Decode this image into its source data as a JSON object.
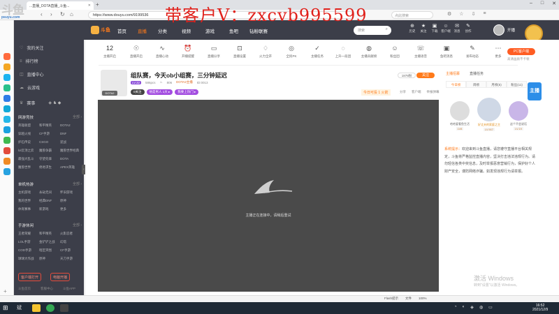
{
  "browser": {
    "tab_title": "...直播_DOTA直播_斗鱼...",
    "url": "https://www.douyu.com/9199536",
    "search_placeholder": "点此搜索"
  },
  "watermark": {
    "logo": "斗鱼",
    "sub": "psuyu.com",
    "contact": "带客户V：zxcvb995599"
  },
  "header": {
    "logo_text": "斗鱼",
    "nav": [
      "首页",
      "直播",
      "分类",
      "视频",
      "游戏",
      "鱼吧",
      "钻粉联赛"
    ],
    "search_placeholder": "搜索",
    "icons": [
      {
        "glyph": "⊕",
        "label": "历史"
      },
      {
        "glyph": "★",
        "label": "关注"
      },
      {
        "glyph": "▣",
        "label": "下载"
      },
      {
        "glyph": "☺",
        "label": "客户端"
      },
      {
        "glyph": "✉",
        "label": "消息"
      },
      {
        "glyph": "✎",
        "label": "创作"
      }
    ],
    "open_live": "开播"
  },
  "sidebar": {
    "items": [
      {
        "icon": "♡",
        "label": "我的关注"
      },
      {
        "icon": "≡",
        "label": "排行榜"
      },
      {
        "icon": "◫",
        "label": "直播中心"
      },
      {
        "icon": "☁",
        "label": "云游戏"
      }
    ],
    "match": "赛事",
    "sections": [
      {
        "title": "网游竞技",
        "all": "全部 ›",
        "games": [
          "英雄联盟",
          "和平精英",
          "DOTA2",
          "穿越火线",
          "CF手游",
          "DNF",
          "炉石传说",
          "CSGO",
          "逆战",
          "lol云顶之弈",
          "魔兽争霸",
          "魔兽世界经典",
          "最强大乱斗",
          "守望先锋",
          "DOTA",
          "魔兽世界",
          "绝地求生",
          "APEX英雄"
        ]
      },
      {
        "title": "单机热游",
        "all": "全部 ›",
        "games": [
          "主机游戏",
          "永劫无间",
          "怀旧游戏",
          "我的世界",
          "经典DNF",
          "原神",
          "体育赛事",
          "新游戏",
          "更多"
        ]
      },
      {
        "title": "手游休闲",
        "all": "全部 ›",
        "games": [
          "王者荣耀",
          "和平精英",
          "火影忍者",
          "LOL手游",
          "金铲铲之战",
          "幻塔",
          "COD手游",
          "暗区突围",
          "CF手游",
          "球球大作战",
          "原神",
          "天刀手游"
        ]
      }
    ],
    "btn_open": "客户端打开",
    "btn_download": "电脑开播",
    "foot": [
      "斗鱼首页",
      "客服中心",
      "斗鱼APP"
    ]
  },
  "toolbar": {
    "count": "12",
    "count_label": "主播开启",
    "items": [
      {
        "glyph": "☉",
        "label": "直播开启"
      },
      {
        "glyph": "∿",
        "label": "直播心动"
      },
      {
        "glyph": "⏰",
        "label": "开播提醒"
      },
      {
        "glyph": "▭",
        "label": "直播分享"
      },
      {
        "glyph": "⊡",
        "label": "直播设置"
      },
      {
        "glyph": "♢",
        "label": "火力全开"
      },
      {
        "glyph": "◎",
        "label": "全民PK"
      },
      {
        "glyph": "✓",
        "label": "主播任务"
      },
      {
        "glyph": "◌",
        "label": "上升一段团"
      },
      {
        "glyph": "◍",
        "label": "主播贡献榜"
      },
      {
        "glyph": "☺",
        "label": "粉丝团"
      },
      {
        "glyph": "☏",
        "label": "主播语音"
      },
      {
        "glyph": "▣",
        "label": "鱼吧消息"
      },
      {
        "glyph": "✎",
        "label": "发布动态"
      },
      {
        "glyph": "⋯",
        "label": "更多"
      }
    ],
    "pc_btn": "PC客户端",
    "pc_sub": "高清画质不卡顿"
  },
  "room": {
    "thumb_tag": "DOTA2",
    "title": "组队赛，今天ob小组赛，三分钟延迟",
    "report": "举报",
    "level": "LV.32",
    "follow_count": "1878粉",
    "follow": "关注",
    "meta": [
      "586pcs",
      "806",
      "DOTA2主播",
      "ID:0013"
    ],
    "tags": [
      {
        "text": "0关注",
        "color": "#444"
      },
      {
        "text": "他是男人 1大 ▸",
        "color": "#a34de0"
      },
      {
        "text": "我要上热门 ▸",
        "color": "#a34de0"
      }
    ],
    "today_rank": "今日可投 1 火箭",
    "share_items": [
      "分享",
      "客户端",
      "举报弹幕"
    ]
  },
  "video": {
    "status": "主播正在连接中，请稍后重试"
  },
  "right": {
    "top_tabs": [
      "主播招募",
      "直播任务"
    ],
    "tabs": [
      "今日榜",
      "周榜",
      "月榜(5)",
      "粉丝(11)"
    ],
    "ranks": [
      {
        "name": "哈哈爱看鱼生活",
        "lv": "LV8"
      },
      {
        "name": "好丈夫的家庭之主",
        "lv": "LV.907"
      },
      {
        "name": "这个不会说话",
        "lv": "LV.19"
      }
    ],
    "chat_key": "系统提示：",
    "chat": "欢迎来到斗鱼直播，请您遵守直播平台相关规定，斗鱼将严格监控直播内容，坚决打击违法违规行为。请勿轻信各类中奖信息，及时举报恶意营销行为，保护好个人财产安全，谨防网络诈骗。如发现违规行为请举报。",
    "win_activate": "激活 Windows",
    "win_activate_sub": "转到\"设置\"以激活 Windows。",
    "gift_badge": "主播"
  },
  "statusbar": [
    "Flash提示",
    "文件",
    "100%"
  ],
  "taskbar": {
    "time": "16:52",
    "date": "2021/12/9"
  }
}
